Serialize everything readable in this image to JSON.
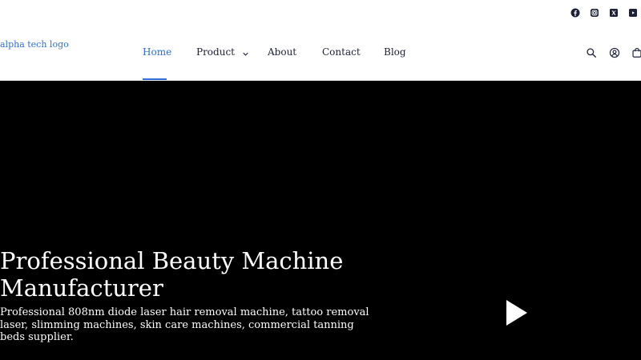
{
  "social": {
    "items": [
      {
        "name": "facebook-icon"
      },
      {
        "name": "instagram-icon"
      },
      {
        "name": "x-twitter-icon"
      },
      {
        "name": "youtube-icon"
      }
    ]
  },
  "header": {
    "logo_text": "alpha tech logo",
    "nav": [
      {
        "label": "Home",
        "active": true
      },
      {
        "label": "Product",
        "has_dropdown": true
      },
      {
        "label": "About"
      },
      {
        "label": "Contact"
      },
      {
        "label": "Blog"
      }
    ],
    "icons": [
      "search-icon",
      "account-icon",
      "cart-icon"
    ]
  },
  "hero": {
    "title": "Professional Beauty Machine Manufacturer",
    "subtitle": "Professional 808nm diode laser hair removal machine, tattoo removal laser, slimming machines, skin care machines, commercial tanning beds supplier.",
    "play_icon": "play-icon"
  },
  "colors": {
    "accent": "#2e6fd6",
    "nav_text": "#1c2135",
    "hero_bg": "#000000"
  }
}
